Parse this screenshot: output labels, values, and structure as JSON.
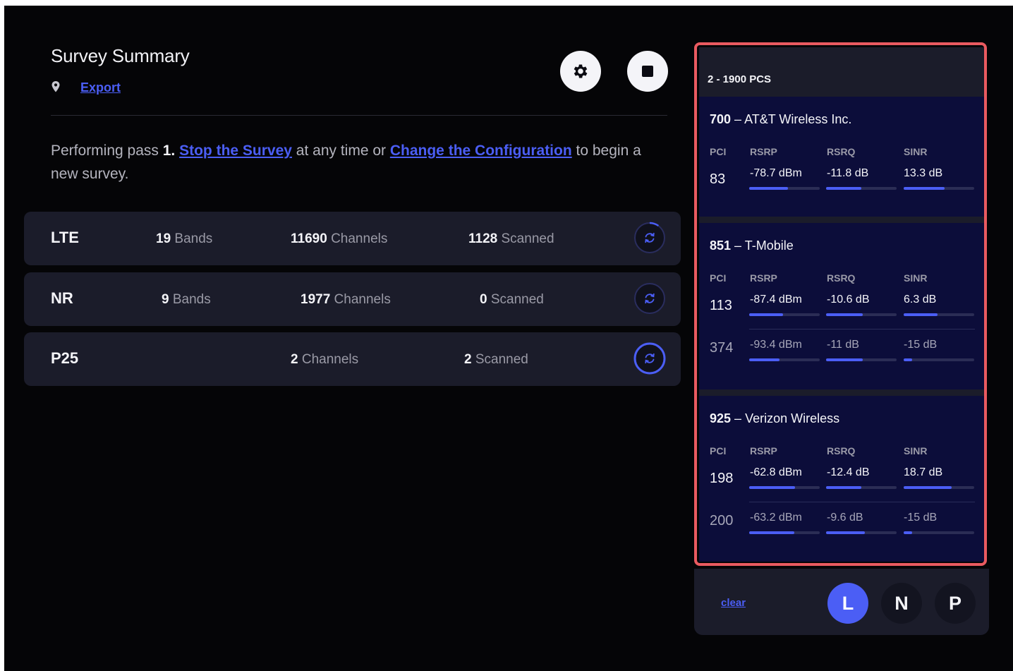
{
  "summary": {
    "title": "Survey Summary",
    "export_label": "Export",
    "status": {
      "prefix": "Performing pass ",
      "pass": "1.",
      "stop_link": "Stop the Survey",
      "middle": " at any time or ",
      "config_link": "Change the Configuration",
      "suffix": " to begin a new survey."
    }
  },
  "technologies": [
    {
      "name": "LTE",
      "bands": "19",
      "bands_label": " Bands",
      "channels": "11690",
      "channels_label": " Channels",
      "scanned": "1128",
      "scanned_label": " Scanned",
      "progress": 0.1
    },
    {
      "name": "NR",
      "bands": "9",
      "bands_label": " Bands",
      "channels": "1977",
      "channels_label": " Channels",
      "scanned": "0",
      "scanned_label": " Scanned",
      "progress": 0.0
    },
    {
      "name": "P25",
      "channels": "2",
      "channels_label": " Channels",
      "scanned": "2",
      "scanned_label": " Scanned",
      "progress": 1.0
    }
  ],
  "band_panel": {
    "title": "2 - 1900 PCS",
    "columns": [
      "PCI",
      "RSRP",
      "RSRQ",
      "SINR"
    ],
    "carriers": [
      {
        "code": "700",
        "sep": " – ",
        "name": "AT&T Wireless Inc.",
        "cells": [
          {
            "pci": "83",
            "rsrp": "-78.7 dBm",
            "rsrq": "-11.8 dB",
            "sinr": "13.3 dB",
            "rsrp_level": 0.55,
            "rsrq_level": 0.5,
            "sinr_level": 0.58
          }
        ]
      },
      {
        "code": "851",
        "sep": " – ",
        "name": "T-Mobile",
        "cells": [
          {
            "pci": "113",
            "rsrp": "-87.4 dBm",
            "rsrq": "-10.6 dB",
            "sinr": "6.3 dB",
            "rsrp_level": 0.48,
            "rsrq_level": 0.52,
            "sinr_level": 0.48
          },
          {
            "pci": "374",
            "rsrp": "-93.4 dBm",
            "rsrq": "-11 dB",
            "sinr": "-15 dB",
            "rsrp_level": 0.43,
            "rsrq_level": 0.52,
            "sinr_level": 0.12
          }
        ]
      },
      {
        "code": "925",
        "sep": " – ",
        "name": "Verizon Wireless",
        "cells": [
          {
            "pci": "198",
            "rsrp": "-62.8 dBm",
            "rsrq": "-12.4 dB",
            "sinr": "18.7 dB",
            "rsrp_level": 0.65,
            "rsrq_level": 0.5,
            "sinr_level": 0.68
          },
          {
            "pci": "200",
            "rsrp": "-63.2 dBm",
            "rsrq": "-9.6 dB",
            "sinr": "-15 dB",
            "rsrp_level": 0.64,
            "rsrq_level": 0.55,
            "sinr_level": 0.12
          }
        ]
      }
    ]
  },
  "filters": {
    "clear_label": "clear",
    "buttons": [
      "L",
      "N",
      "P"
    ],
    "active": "L"
  },
  "colors": {
    "accent": "#4b5ef5",
    "highlight": "#ea5a60",
    "row_bg": "#1b1c2a",
    "carrier_bg": "#0c0d3a"
  }
}
